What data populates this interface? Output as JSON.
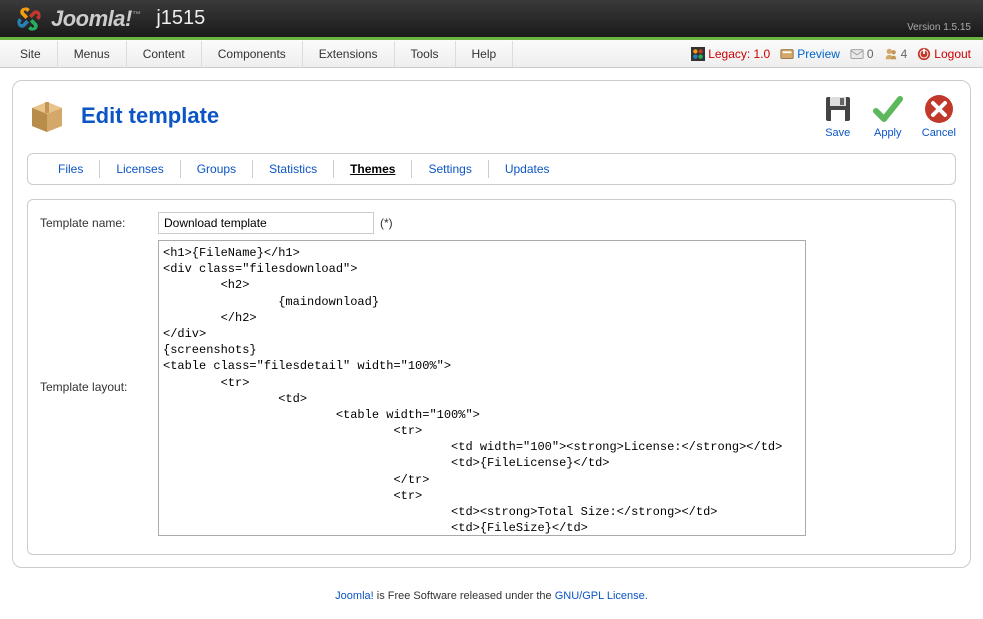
{
  "header": {
    "brand": "Joomla!",
    "site_name": "j1515",
    "version": "Version 1.5.15"
  },
  "menubar": {
    "items": [
      "Site",
      "Menus",
      "Content",
      "Components",
      "Extensions",
      "Tools",
      "Help"
    ],
    "right": {
      "legacy": "Legacy: 1.0",
      "preview": "Preview",
      "messages": "0",
      "users": "4",
      "logout": "Logout"
    }
  },
  "page": {
    "title": "Edit template",
    "toolbar": {
      "save": "Save",
      "apply": "Apply",
      "cancel": "Cancel"
    }
  },
  "submenu": {
    "items": [
      "Files",
      "Licenses",
      "Groups",
      "Statistics",
      "Themes",
      "Settings",
      "Updates"
    ],
    "active_index": 4
  },
  "form": {
    "name_label": "Template name:",
    "name_value": "Download template",
    "required": "(*)",
    "layout_label": "Template layout:",
    "layout_value": "<h1>{FileName}</h1>\n<div class=\"filesdownload\">\n        <h2>\n                {maindownload}\n        </h2>\n</div>\n{screenshots}\n<table class=\"filesdetail\" width=\"100%\">\n        <tr>\n                <td>\n                        <table width=\"100%\">\n                                <tr>\n                                        <td width=\"100\"><strong>License:</strong></td>\n                                        <td>{FileLicense}</td>\n                                </tr>\n                                <tr>\n                                        <td><strong>Total Size:</strong></td>\n                                        <td>{FileSize}</td>\n                                </tr>\n                                <tr>\n                                        <td><strong>File Version:</strong></td>"
  },
  "footer": {
    "prefix": "Joomla!",
    "mid": " is Free Software released under the ",
    "link": "GNU/GPL License."
  }
}
